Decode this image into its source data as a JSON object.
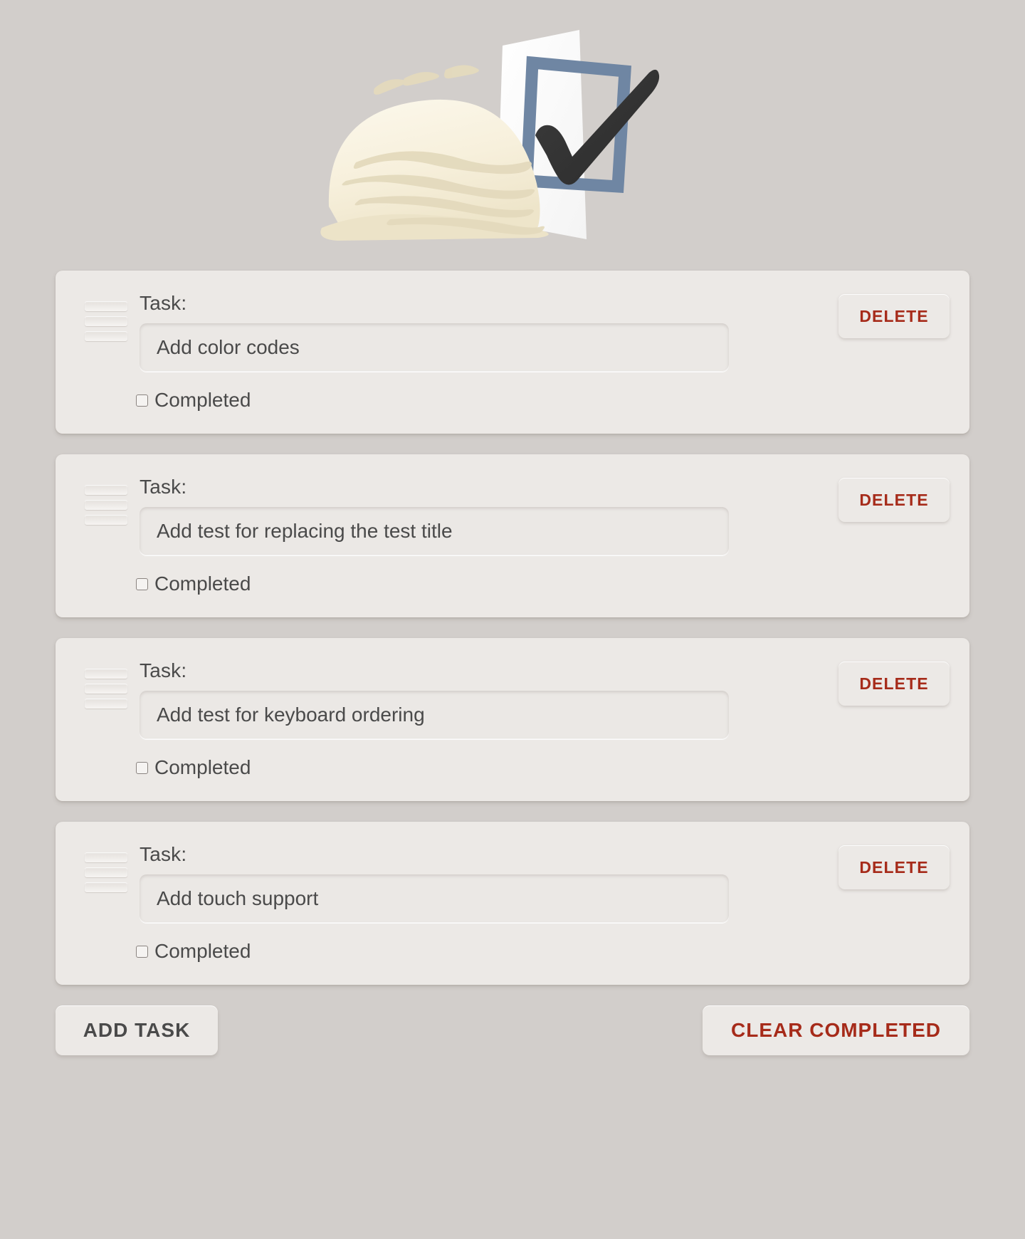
{
  "app": {
    "logo_icon": "ice-cream-scoop-with-checklist-icon"
  },
  "task_list": {
    "task_label": "Task:",
    "completed_label": "Completed",
    "delete_label": "DELETE",
    "drag_handle_icon": "drag-handle-icon",
    "items": [
      {
        "value": "Add color codes",
        "completed": false
      },
      {
        "value": "Add test for replacing the test title",
        "completed": false
      },
      {
        "value": "Add test for keyboard ordering",
        "completed": false
      },
      {
        "value": "Add touch support",
        "completed": false
      }
    ]
  },
  "footer": {
    "add_task_label": "ADD TASK",
    "clear_completed_label": "CLEAR COMPLETED"
  },
  "colors": {
    "background": "#d2cecb",
    "card": "#ece9e6",
    "danger_text": "#a62b1a",
    "primary_text": "#4a4a4a",
    "logo_checkbox": "#6f86a3",
    "logo_scoop": "#f6efdc"
  }
}
